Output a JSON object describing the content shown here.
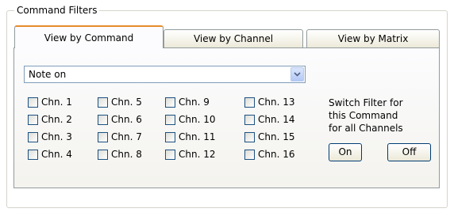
{
  "group": {
    "title": "Command Filters"
  },
  "tabs": [
    {
      "label": "View by Command",
      "active": true
    },
    {
      "label": "View by Channel",
      "active": false
    },
    {
      "label": "View by Matrix",
      "active": false
    }
  ],
  "command_select": {
    "value": "Note on",
    "icon": "chevron-down-icon"
  },
  "channels": [
    {
      "label": "Chn. 1",
      "checked": false
    },
    {
      "label": "Chn. 2",
      "checked": false
    },
    {
      "label": "Chn. 3",
      "checked": false
    },
    {
      "label": "Chn. 4",
      "checked": false
    },
    {
      "label": "Chn. 5",
      "checked": false
    },
    {
      "label": "Chn. 6",
      "checked": false
    },
    {
      "label": "Chn. 7",
      "checked": false
    },
    {
      "label": "Chn. 8",
      "checked": false
    },
    {
      "label": "Chn. 9",
      "checked": false
    },
    {
      "label": "Chn. 10",
      "checked": false
    },
    {
      "label": "Chn. 11",
      "checked": false
    },
    {
      "label": "Chn. 12",
      "checked": false
    },
    {
      "label": "Chn. 13",
      "checked": false
    },
    {
      "label": "Chn. 14",
      "checked": false
    },
    {
      "label": "Chn. 15",
      "checked": false
    },
    {
      "label": "Chn. 16",
      "checked": false
    }
  ],
  "switch_info": {
    "line1": "Switch Filter for",
    "line2": "this Command",
    "line3": "for all Channels"
  },
  "buttons": {
    "on_label": "On",
    "off_label": "Off"
  },
  "colors": {
    "tab_active_accent": "#e68b2c",
    "border": "#919b9c",
    "checkbox_border": "#1c5180"
  }
}
